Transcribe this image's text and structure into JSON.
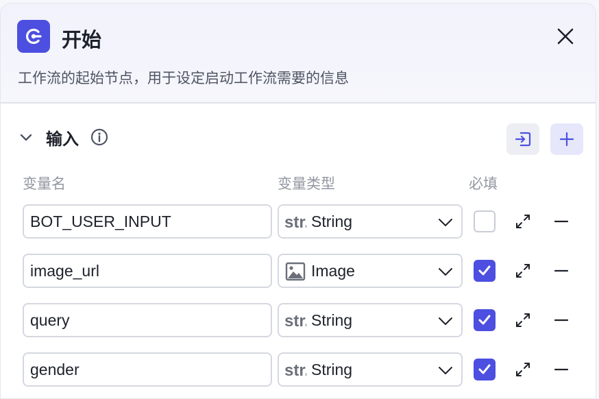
{
  "node": {
    "title": "开始",
    "description": "工作流的起始节点，用于设定启动工作流需要的信息",
    "icon": "start-node-icon",
    "accent_color": "#4c4fe0"
  },
  "section": {
    "title": "输入",
    "expanded": true
  },
  "columns": {
    "name": "变量名",
    "type": "变量类型",
    "required": "必填"
  },
  "rows": [
    {
      "name": "BOT_USER_INPUT",
      "type": "String",
      "type_icon": "string-type-icon",
      "required": false
    },
    {
      "name": "image_url",
      "type": "Image",
      "type_icon": "image-type-icon",
      "required": true
    },
    {
      "name": "query",
      "type": "String",
      "type_icon": "string-type-icon",
      "required": true
    },
    {
      "name": "gender",
      "type": "String",
      "type_icon": "string-type-icon",
      "required": true
    }
  ]
}
